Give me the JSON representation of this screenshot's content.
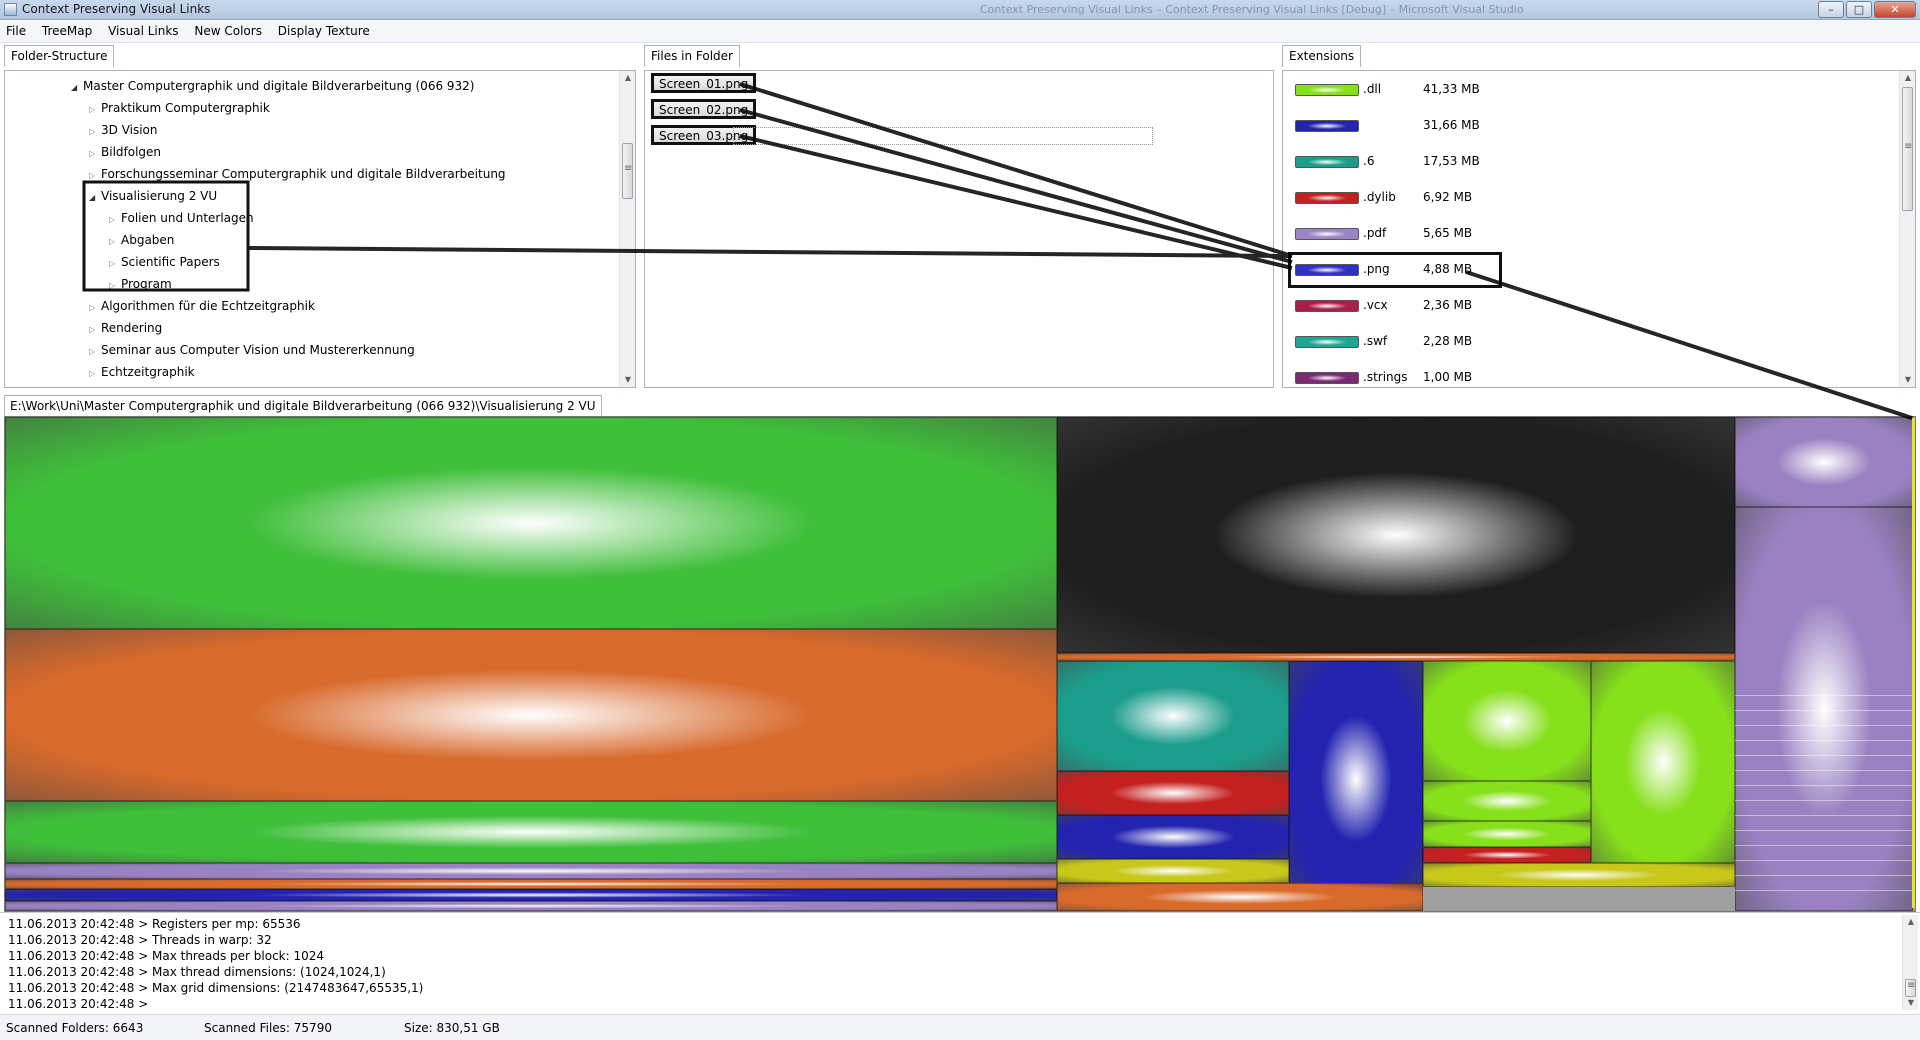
{
  "window": {
    "title": "Context Preserving Visual Links",
    "ghost_title": "Context Preserving Visual Links – Context Preserving Visual Links [Debug] – Microsoft Visual Studio"
  },
  "menu": [
    "File",
    "TreeMap",
    "Visual Links",
    "New Colors",
    "Display Texture"
  ],
  "folder_panel": {
    "tab": "Folder-Structure",
    "items": [
      {
        "label": "Master Computergraphik und digitale Bildverarbeitung (066 932)",
        "expander": "◢",
        "level": 0
      },
      {
        "label": "Praktikum Computergraphik",
        "expander": "▷",
        "level": 1
      },
      {
        "label": "3D Vision",
        "expander": "▷",
        "level": 1
      },
      {
        "label": "Bildfolgen",
        "expander": "▷",
        "level": 1
      },
      {
        "label": "Forschungsseminar Computergraphik und digitale Bildverarbeitung",
        "expander": "▷",
        "level": 1
      },
      {
        "label": "Visualisierung 2 VU",
        "expander": "◢",
        "level": 1
      },
      {
        "label": "Folien und Unterlagen",
        "expander": "▷",
        "level": 2
      },
      {
        "label": "Abgaben",
        "expander": "▷",
        "level": 2
      },
      {
        "label": "Scientific Papers",
        "expander": "▷",
        "level": 2
      },
      {
        "label": "Program",
        "expander": "▷",
        "level": 2
      },
      {
        "label": "Algorithmen für die Echtzeitgraphik",
        "expander": "▷",
        "level": 1
      },
      {
        "label": "Rendering",
        "expander": "▷",
        "level": 1
      },
      {
        "label": "Seminar aus Computer Vision und Mustererkennung",
        "expander": "▷",
        "level": 1
      },
      {
        "label": "Echtzeitgraphik",
        "expander": "▷",
        "level": 1
      }
    ]
  },
  "files_panel": {
    "tab": "Files in Folder",
    "items": [
      "Screen_01.png",
      "Screen_02.png",
      "Screen_03.png"
    ]
  },
  "extensions_panel": {
    "tab": "Extensions",
    "items": [
      {
        "ext": ".dll",
        "size": "41,33 MB",
        "color": "#86e01a"
      },
      {
        "ext": "",
        "size": "31,66 MB",
        "color": "#2323b0"
      },
      {
        "ext": ".6",
        "size": "17,53 MB",
        "color": "#1c9d8c"
      },
      {
        "ext": ".dylib",
        "size": "6,92 MB",
        "color": "#c42020"
      },
      {
        "ext": ".pdf",
        "size": "5,65 MB",
        "color": "#9a84c4"
      },
      {
        "ext": ".png",
        "size": "4,88 MB",
        "color": "#3030c8"
      },
      {
        "ext": ".vcx",
        "size": "2,36 MB",
        "color": "#a8204a"
      },
      {
        "ext": ".swf",
        "size": "2,28 MB",
        "color": "#1aa892"
      },
      {
        "ext": ".strings",
        "size": "1,00 MB",
        "color": "#7a2a70"
      }
    ]
  },
  "path_tab": "E:\\Work\\Uni\\Master Computergraphik und digitale Bildverarbeitung (066 932)\\Visualisierung 2 VU",
  "log": [
    {
      "ts": "11.06.2013 20:42:48 >",
      "msg": "Registers per mp:  65536"
    },
    {
      "ts": "11.06.2013 20:42:48 >",
      "msg": "Threads in warp:  32"
    },
    {
      "ts": "11.06.2013 20:42:48 >",
      "msg": "Max threads per block:  1024"
    },
    {
      "ts": "11.06.2013 20:42:48 >",
      "msg": "Max thread dimensions:  (1024,1024,1)"
    },
    {
      "ts": "11.06.2013 20:42:48 >",
      "msg": "Max grid dimensions:  (2147483647,65535,1)"
    },
    {
      "ts": "11.06.2013 20:42:48 >",
      "msg": ""
    }
  ],
  "status": {
    "folders": "Scanned Folders: 6643",
    "files": "Scanned Files: 75790",
    "size": "Size: 830,51 GB"
  },
  "treemap_colors": {
    "green": "#3fbf3a",
    "orange": "#d86a2c",
    "black": "#1e1e1e",
    "purple": "#9a82c2",
    "teal": "#1c9d8c",
    "red": "#c42020",
    "blue": "#2323b0",
    "lime": "#86e01a",
    "yellow": "#c8c81a"
  }
}
